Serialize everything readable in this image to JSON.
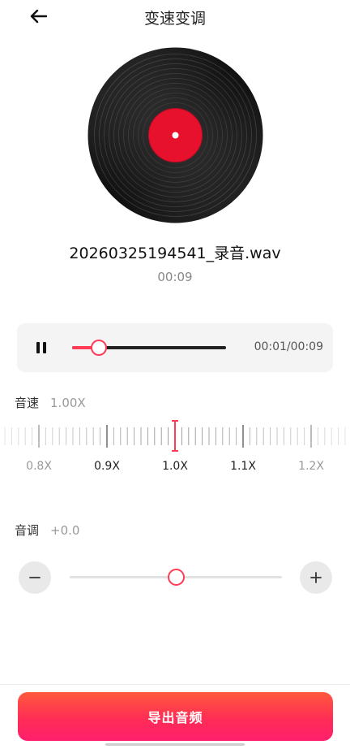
{
  "header": {
    "title": "变速变调",
    "back_icon": "arrow-left-icon"
  },
  "record": {
    "file_name": "20260325194541_录音.wav",
    "duration": "00:09",
    "label_color": "#e8112d"
  },
  "player": {
    "state_icon": "pause-icon",
    "progress": 0.17,
    "time_text": "00:01/00:09"
  },
  "speed": {
    "label": "音速",
    "value_text": "1.00X",
    "ticks": [
      "0.8X",
      "0.9X",
      "1.0X",
      "1.1X",
      "1.2X"
    ],
    "selected": 1.0
  },
  "pitch": {
    "label": "音调",
    "value_text": "+0.0",
    "position": 0.5
  },
  "export": {
    "label": "导出音频"
  },
  "colors": {
    "accent": "#ff3b55",
    "export_gradient_start": "#ff5a3c",
    "export_gradient_end": "#ff1f6e"
  }
}
